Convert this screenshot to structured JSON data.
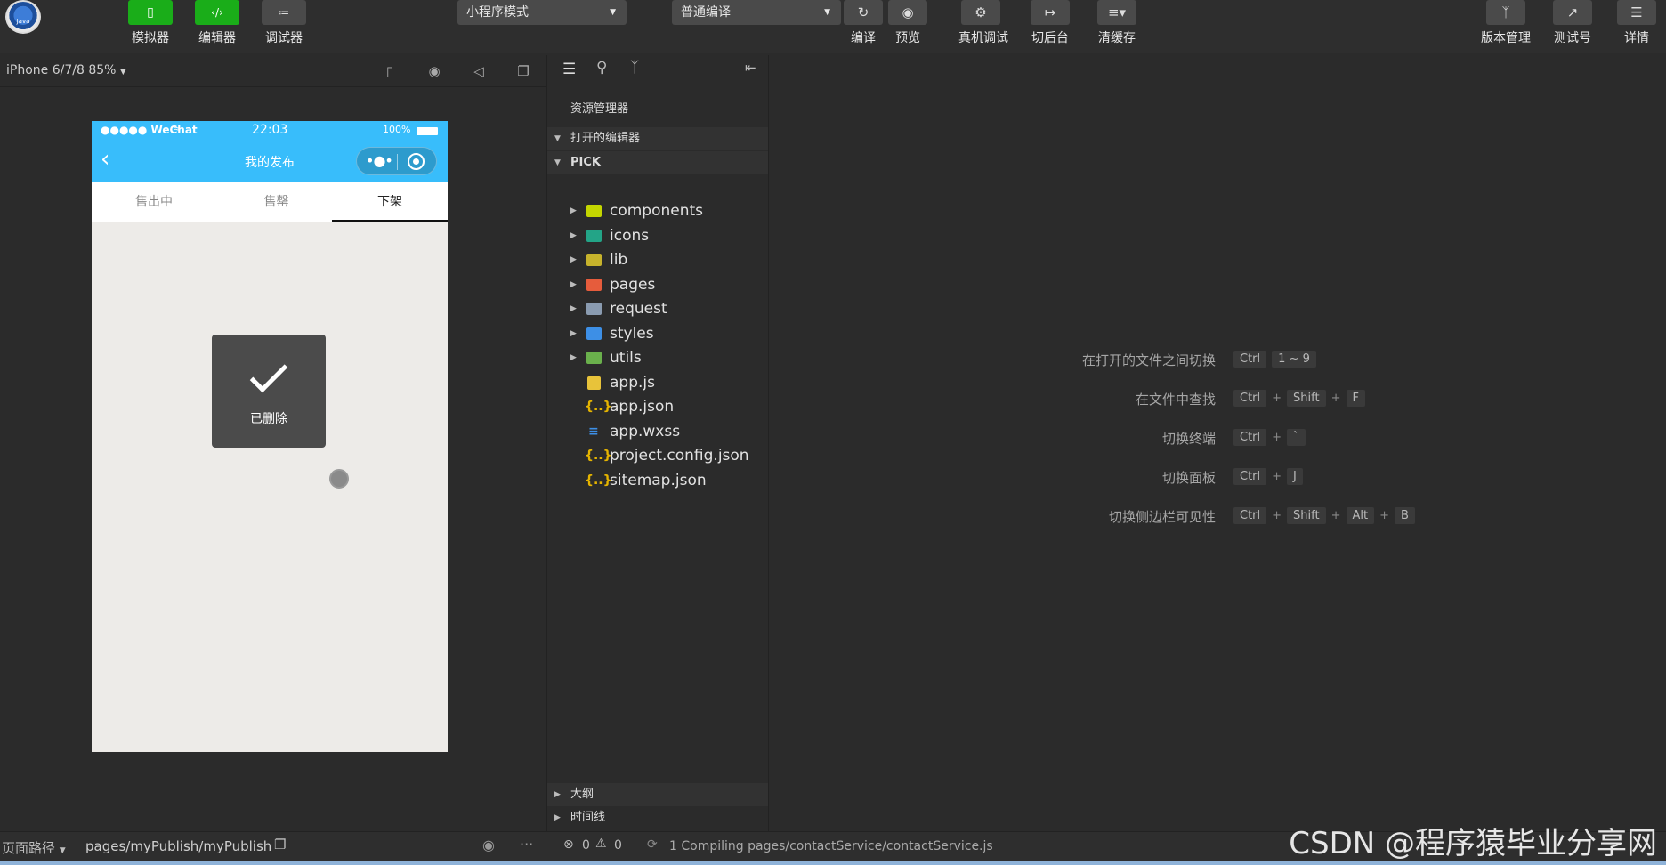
{
  "toolbar": {
    "buttons": {
      "simulator": "模拟器",
      "editor": "编辑器",
      "debugger": "调试器",
      "compile": "编译",
      "preview": "预览",
      "real_debug": "真机调试",
      "background": "切后台",
      "clear_cache": "清缓存",
      "version": "版本管理",
      "test_id": "测试号",
      "details": "详情"
    },
    "mode_select": "小程序模式",
    "compile_select": "普通编译",
    "avatar_text": "Java"
  },
  "simulator": {
    "device": "iPhone 6/7/8 85%",
    "status_left": "●●●●● WeChat",
    "status_time": "22:03",
    "status_battery": "100%",
    "nav_title": "我的发布",
    "tabs": [
      "售出中",
      "售罄",
      "下架"
    ],
    "active_tab": "下架",
    "toast_text": "已删除"
  },
  "explorer": {
    "title": "资源管理器",
    "open_editors": "打开的编辑器",
    "project": "PICK",
    "items": [
      {
        "name": "components",
        "type": "folder",
        "color": "#c4d600"
      },
      {
        "name": "icons",
        "type": "folder",
        "color": "#23a487"
      },
      {
        "name": "lib",
        "type": "folder",
        "color": "#c7b32c"
      },
      {
        "name": "pages",
        "type": "folder",
        "color": "#e65c3c"
      },
      {
        "name": "request",
        "type": "folder",
        "color": "#8a9bb0"
      },
      {
        "name": "styles",
        "type": "folder",
        "color": "#3d8fe6"
      },
      {
        "name": "utils",
        "type": "folder",
        "color": "#6ab04c"
      },
      {
        "name": "app.js",
        "type": "js",
        "color": "#e8c33a"
      },
      {
        "name": "app.json",
        "type": "json",
        "color": "#e5b400"
      },
      {
        "name": "app.wxss",
        "type": "css",
        "color": "#3d8fe6"
      },
      {
        "name": "project.config.json",
        "type": "json",
        "color": "#e5b400"
      },
      {
        "name": "sitemap.json",
        "type": "json",
        "color": "#e5b400"
      }
    ],
    "outline": "大纲",
    "timeline": "时间线"
  },
  "shortcuts": [
    {
      "label": "在打开的文件之间切换",
      "keys": [
        "Ctrl",
        "1 ~ 9"
      ]
    },
    {
      "label": "在文件中查找",
      "keys": [
        "Ctrl",
        "+",
        "Shift",
        "+",
        "F"
      ]
    },
    {
      "label": "切换终端",
      "keys": [
        "Ctrl",
        "+",
        "`"
      ]
    },
    {
      "label": "切换面板",
      "keys": [
        "Ctrl",
        "+",
        "J"
      ]
    },
    {
      "label": "切换侧边栏可见性",
      "keys": [
        "Ctrl",
        "+",
        "Shift",
        "+",
        "Alt",
        "+",
        "B"
      ]
    }
  ],
  "statusbar": {
    "page_path_label": "页面路径",
    "page_path": "pages/myPublish/myPublish",
    "errors": "0",
    "warnings": "0",
    "compiling": "1 Compiling pages/contactService/contactService.js"
  },
  "watermark": "CSDN @程序猿毕业分享网"
}
